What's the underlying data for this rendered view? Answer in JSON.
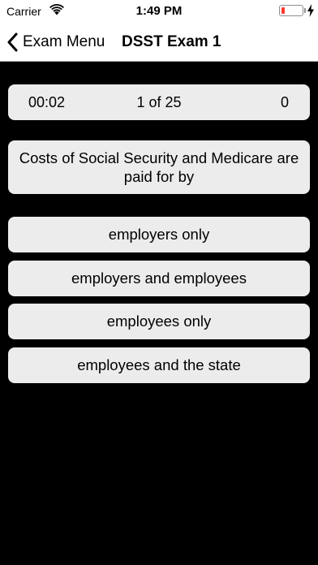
{
  "status_bar": {
    "carrier": "Carrier",
    "time": "1:49 PM",
    "battery_color": "#ff3b30"
  },
  "nav": {
    "back_label": "Exam Menu",
    "title": "DSST Exam 1"
  },
  "quiz": {
    "timer": "00:02",
    "progress": "1 of 25",
    "score": "0",
    "question": "Costs of Social Security and Medicare are paid for by",
    "answers": [
      "employers only",
      "employers and employees",
      "employees only",
      "employees and the state"
    ]
  }
}
